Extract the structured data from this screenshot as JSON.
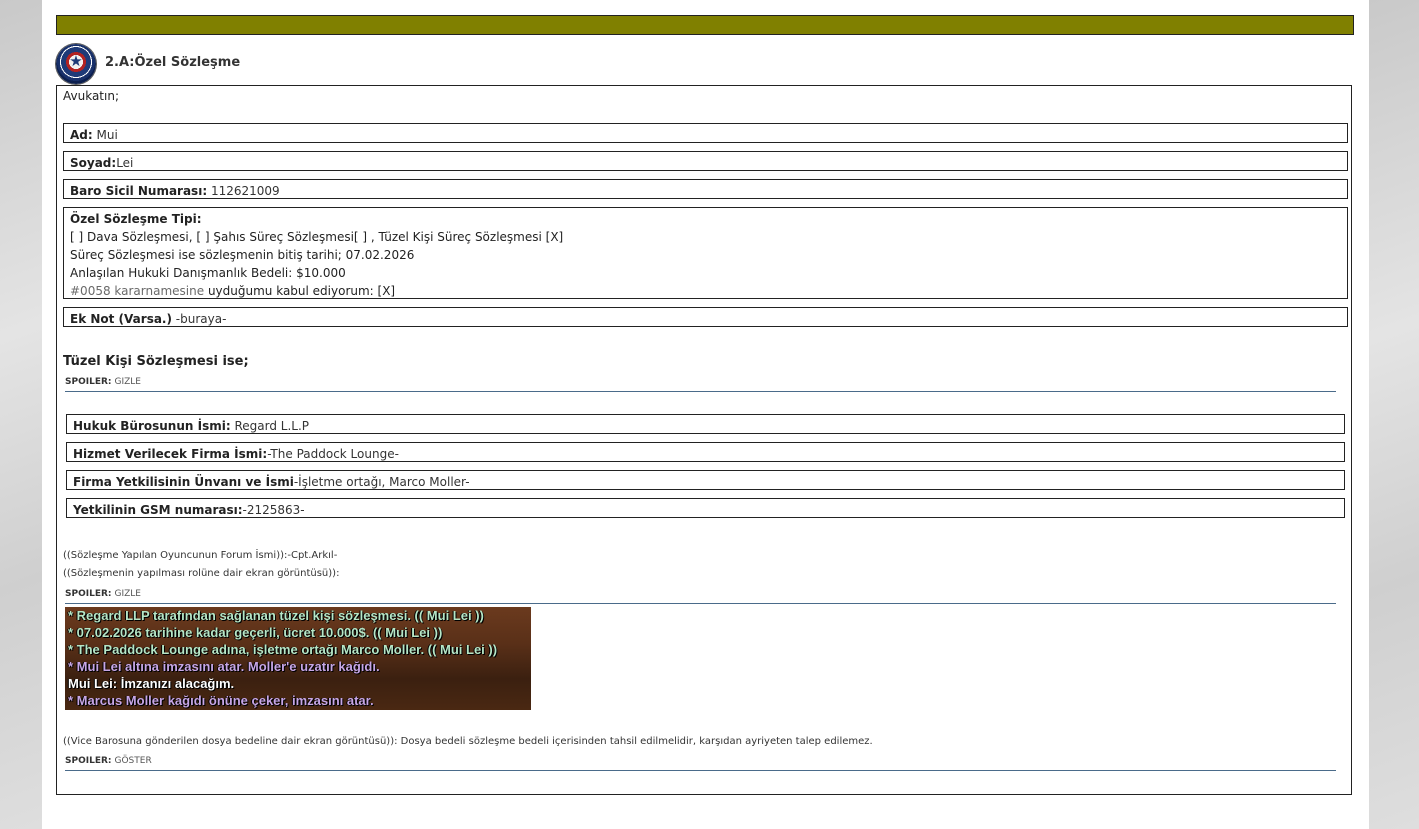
{
  "document": {
    "title": "2.A:Özel Sözleşme",
    "intro": "Avukatın;",
    "fields": {
      "ad": {
        "label": "Ad:",
        "value": " Mui"
      },
      "soyad": {
        "label": "Soyad:",
        "value": "Lei"
      },
      "baro": {
        "label": "Baro Sicil Numarası:",
        "value": " 112621009"
      }
    },
    "contract_type": {
      "label": "Özel Sözleşme Tipi:",
      "line1": "[ ] Dava Sözleşmesi, [ ] Şahıs Süreç Sözleşmesi[ ] , Tüzel Kişi Süreç Sözleşmesi [X]",
      "line2": "Süreç Sözleşmesi ise sözleşmenin bitiş tarihi; 07.02.2026",
      "line3": "Anlaşılan Hukuki Danışmanlık Bedeli: $10.000",
      "line4_link": "#0058 kararnamesine",
      "line4_rest": " uyduğumu kabul ediyorum: [X]"
    },
    "ek_not": {
      "label": "Ek Not (Varsa.)",
      "value": " -buraya-"
    },
    "tuzel_heading": "Tüzel Kişi Sözleşmesi ise;",
    "spoiler1": {
      "label": "SPOILER:",
      "action": "GIZLE"
    },
    "company_fields": {
      "buro": {
        "label": "Hukuk Bürosunun İsmi:",
        "value": " Regard L.L.P"
      },
      "firma": {
        "label": "Hizmet Verilecek Firma İsmi:",
        "value": "-The Paddock Lounge-"
      },
      "yetkili": {
        "label": "Firma Yetkilisinin Ünvanı ve İsmi",
        "value": "-İşletme ortağı, Marco Moller-"
      },
      "gsm": {
        "label": "Yetkilinin GSM numarası:",
        "value": "-2125863-"
      }
    },
    "forum_name": "((Sözleşme Yapılan Oyuncunun Forum İsmi)):-Cpt.Arkıl-",
    "screenshot_caption": "((Sözleşmenin yapılması rolüne dair ekran görüntüsü)):",
    "spoiler2": {
      "label": "SPOILER:",
      "action": "GIZLE"
    },
    "chat_lines": [
      "* Regard LLP tarafından sağlanan tüzel kişi sözleşmesi. (( Mui Lei ))",
      "* 07.02.2026 tarihine kadar geçerli, ücret 10.000$. (( Mui Lei ))",
      "* The Paddock Lounge adına, işletme ortağı Marco Moller. (( Mui Lei ))",
      "* Mui Lei altına imzasını atar. Moller'e uzatır kağıdı.",
      "Mui Lei: İmzanızı alacağım.",
      "* Marcus Moller kağıdı önüne çeker, imzasını atar."
    ],
    "fee_note": "((Vice Barosuna gönderilen dosya bedeline dair ekran görüntüsü)): Dosya bedeli sözleşme bedeli içerisinden tahsil edilmelidir, karşıdan ayriyeten talep edilemez.",
    "spoiler3": {
      "label": "SPOILER:",
      "action": "GÖSTER"
    }
  },
  "colors": {
    "header_bar": "#808000",
    "chat_green": "#b6e6c6",
    "chat_purple": "#c7a6e6",
    "chat_white": "#ffffff"
  }
}
